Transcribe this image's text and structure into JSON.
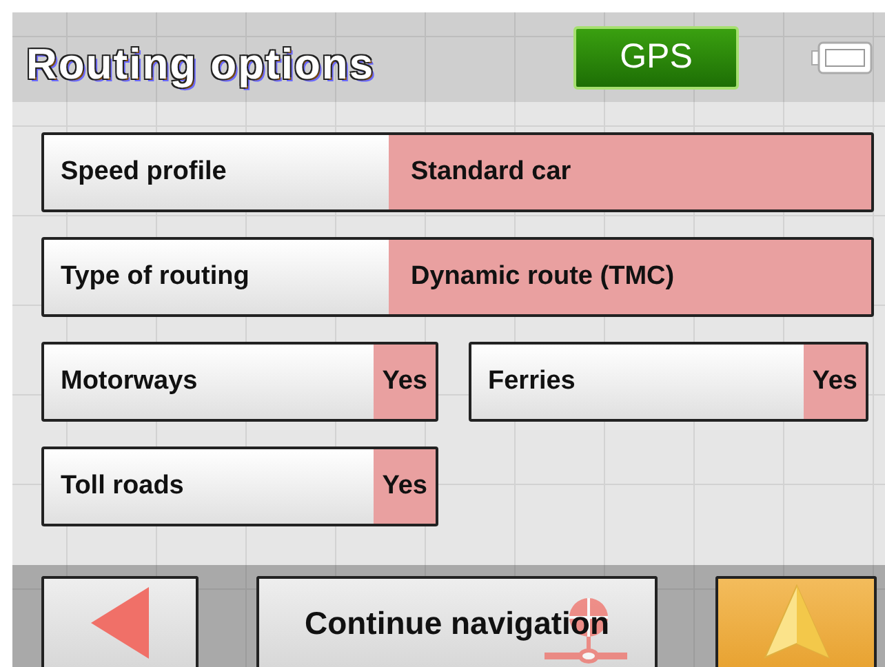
{
  "header": {
    "title": "Routing options",
    "gps_label": "GPS"
  },
  "options": [
    {
      "kind": "wide",
      "label": "Speed profile",
      "value": "Standard car"
    },
    {
      "kind": "wide",
      "label": "Type of routing",
      "value": "Dynamic route (TMC)"
    },
    {
      "kind": "half",
      "label": "Motorways",
      "value": "Yes"
    },
    {
      "kind": "half",
      "label": "Ferries",
      "value": "Yes"
    },
    {
      "kind": "half",
      "label": "Toll roads",
      "value": "Yes"
    }
  ],
  "footer": {
    "continue_label": "Continue navigation"
  }
}
